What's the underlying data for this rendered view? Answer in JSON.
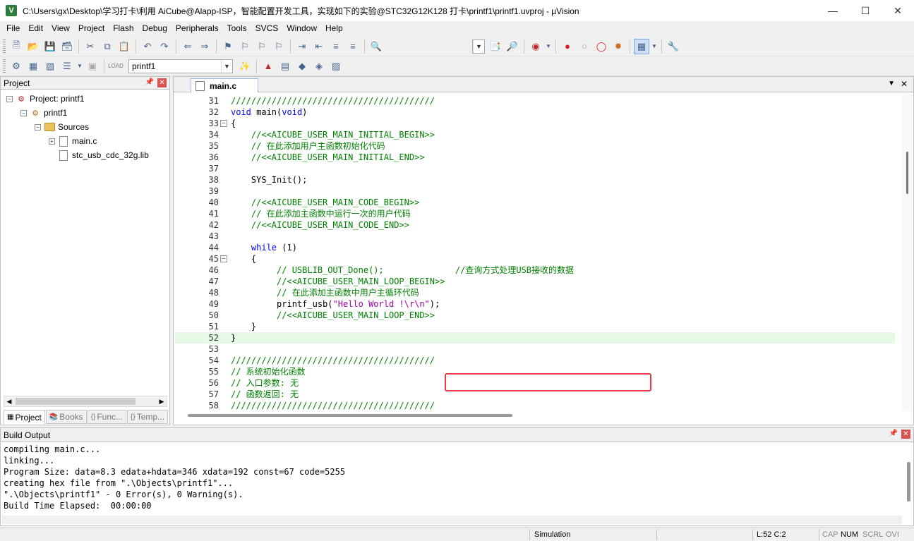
{
  "window": {
    "title": "C:\\Users\\gx\\Desktop\\学习打卡\\利用 AiCube@Alapp-ISP，智能配置开发工具，实现如下的实验@STC32G12K128 打卡\\printf1\\printf1.uvproj - µVision",
    "app_icon": "V"
  },
  "menu": [
    "File",
    "Edit",
    "View",
    "Project",
    "Flash",
    "Debug",
    "Peripherals",
    "Tools",
    "SVCS",
    "Window",
    "Help"
  ],
  "toolbar": {
    "target_select": "printf1"
  },
  "project_panel": {
    "title": "Project",
    "root": "Project: printf1",
    "target": "printf1",
    "group": "Sources",
    "files": [
      "main.c",
      "stc_usb_cdc_32g.lib"
    ],
    "tabs": [
      "Project",
      "Books",
      "Func...",
      "Temp..."
    ],
    "tab_icons": [
      "",
      "",
      "{}",
      "{}"
    ]
  },
  "editor": {
    "tab_label": "main.c",
    "lines": [
      {
        "n": "31",
        "t": "////////////////////////////////////////"
      },
      {
        "n": "32",
        "t": "void main(void)"
      },
      {
        "n": "33",
        "t": "{"
      },
      {
        "n": "34",
        "t": "    //<<AICUBE_USER_MAIN_INITIAL_BEGIN>>"
      },
      {
        "n": "35",
        "t": "    // 在此添加用户主函数初始化代码"
      },
      {
        "n": "36",
        "t": "    //<<AICUBE_USER_MAIN_INITIAL_END>>"
      },
      {
        "n": "37",
        "t": ""
      },
      {
        "n": "38",
        "t": "    SYS_Init();"
      },
      {
        "n": "39",
        "t": ""
      },
      {
        "n": "40",
        "t": "    //<<AICUBE_USER_MAIN_CODE_BEGIN>>"
      },
      {
        "n": "41",
        "t": "    // 在此添加主函数中运行一次的用户代码"
      },
      {
        "n": "42",
        "t": "    //<<AICUBE_USER_MAIN_CODE_END>>"
      },
      {
        "n": "43",
        "t": ""
      },
      {
        "n": "44",
        "t": "    while (1)"
      },
      {
        "n": "45",
        "t": "    {"
      },
      {
        "n": "46",
        "t": "         // USBLIB_OUT_Done();              //查询方式处理USB接收的数据"
      },
      {
        "n": "47",
        "t": "         //<<AICUBE_USER_MAIN_LOOP_BEGIN>>"
      },
      {
        "n": "48",
        "t": "         // 在此添加主函数中用户主循环代码"
      },
      {
        "n": "49",
        "t": "         printf_usb(\"Hello World !\\r\\n\");"
      },
      {
        "n": "50",
        "t": "         //<<AICUBE_USER_MAIN_LOOP_END>>"
      },
      {
        "n": "51",
        "t": "    }"
      },
      {
        "n": "52",
        "t": "}"
      },
      {
        "n": "53",
        "t": ""
      },
      {
        "n": "54",
        "t": "////////////////////////////////////////"
      },
      {
        "n": "55",
        "t": "// 系统初始化函数"
      },
      {
        "n": "56",
        "t": "// 入口参数: 无"
      },
      {
        "n": "57",
        "t": "// 函数返回: 无"
      },
      {
        "n": "58",
        "t": "////////////////////////////////////////"
      }
    ]
  },
  "build_output": {
    "title": "Build Output",
    "lines": [
      "compiling main.c...",
      "linking...",
      "Program Size: data=8.3 edata+hdata=346 xdata=192 const=67 code=5255",
      "creating hex file from \".\\Objects\\printf1\"...",
      "\".\\Objects\\printf1\" - 0 Error(s), 0 Warning(s).",
      "Build Time Elapsed:  00:00:00"
    ]
  },
  "status": {
    "mode": "Simulation",
    "position": "L:52 C:2",
    "cap": "CAP",
    "num": "NUM",
    "scrl": "SCRL",
    "ovr": "OVI"
  },
  "colors": {
    "comment": "#008000",
    "keyword": "#0000ff",
    "string": "#a000a0",
    "current_line": "#e5f9e5",
    "annotation_box": "#e8394a"
  }
}
